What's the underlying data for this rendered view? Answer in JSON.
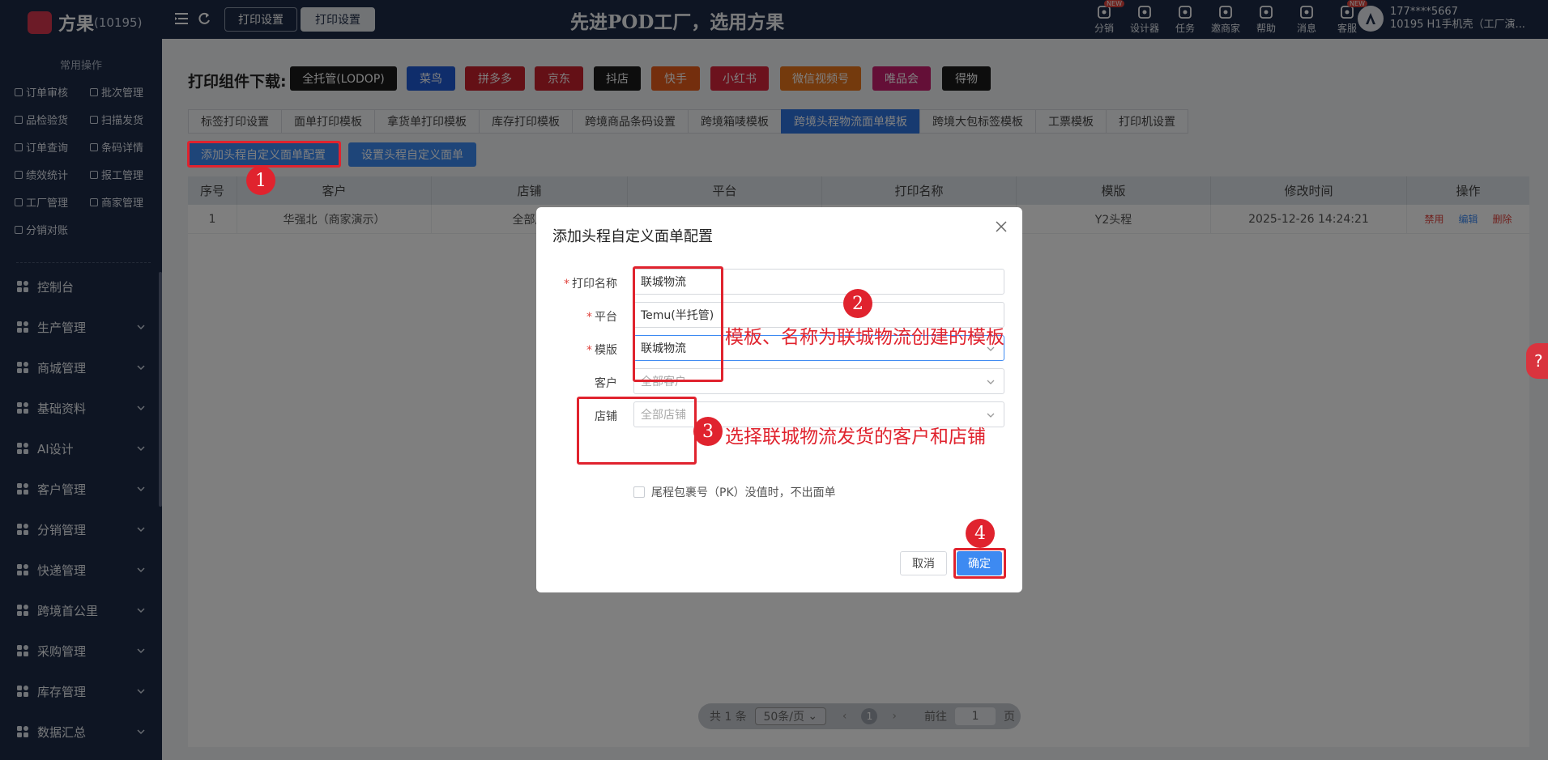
{
  "header": {
    "brand": "方果",
    "brand_code": "(10195)",
    "tabs": [
      "打印设置",
      "打印设置"
    ],
    "slogan": "先进POD工厂，选用方果",
    "icons": [
      {
        "label": "分销",
        "icon": "distribution-icon",
        "badge": "NEW"
      },
      {
        "label": "设计器",
        "icon": "image-icon",
        "badge": ""
      },
      {
        "label": "任务",
        "icon": "task-icon",
        "badge": ""
      },
      {
        "label": "邀商家",
        "icon": "invite-icon",
        "badge": ""
      },
      {
        "label": "帮助",
        "icon": "help-icon",
        "badge": ""
      },
      {
        "label": "消息",
        "icon": "message-icon",
        "badge": ""
      },
      {
        "label": "客服",
        "icon": "service-icon",
        "badge": "NEW"
      }
    ],
    "user_phone": "177****5667",
    "user_shop": "10195  H1手机壳（工厂演..."
  },
  "sidebar": {
    "quick_title": "常用操作",
    "quick_items": [
      "订单审核",
      "批次管理",
      "品检验货",
      "扫描发货",
      "订单查询",
      "条码详情",
      "绩效统计",
      "报工管理",
      "工厂管理",
      "商家管理",
      "分销对账"
    ],
    "menu": [
      {
        "label": "控制台",
        "icon": "dashboard-icon",
        "expandable": false
      },
      {
        "label": "生产管理",
        "icon": "production-icon",
        "expandable": true
      },
      {
        "label": "商城管理",
        "icon": "mall-icon",
        "expandable": true
      },
      {
        "label": "基础资料",
        "icon": "database-icon",
        "expandable": true
      },
      {
        "label": "AI设计",
        "icon": "ai-icon",
        "expandable": true
      },
      {
        "label": "客户管理",
        "icon": "customer-icon",
        "expandable": true
      },
      {
        "label": "分销管理",
        "icon": "distribution-icon",
        "expandable": true
      },
      {
        "label": "快递管理",
        "icon": "express-icon",
        "expandable": true
      },
      {
        "label": "跨境首公里",
        "icon": "globe-icon",
        "expandable": true
      },
      {
        "label": "采购管理",
        "icon": "purchase-icon",
        "expandable": true
      },
      {
        "label": "库存管理",
        "icon": "inventory-icon",
        "expandable": true
      },
      {
        "label": "数据汇总",
        "icon": "chart-icon",
        "expandable": true
      }
    ]
  },
  "downloads": {
    "label": "打印组件下载:",
    "buttons": [
      {
        "label": "全托管(LODOP)",
        "color": "#1a1a1a"
      },
      {
        "label": "菜鸟",
        "color": "#1e5bd6"
      },
      {
        "label": "拼多多",
        "color": "#c8202c"
      },
      {
        "label": "京东",
        "color": "#c8202c"
      },
      {
        "label": "抖店",
        "color": "#1a1a1a"
      },
      {
        "label": "快手",
        "color": "#e85c1a"
      },
      {
        "label": "小红书",
        "color": "#d8243a"
      },
      {
        "label": "微信视频号",
        "color": "#e8741a"
      },
      {
        "label": "唯品会",
        "color": "#c81e6e"
      },
      {
        "label": "得物",
        "color": "#1a1a1a"
      }
    ]
  },
  "tabs": [
    "标签打印设置",
    "面单打印模板",
    "拿货单打印模板",
    "库存打印模板",
    "跨境商品条码设置",
    "跨境箱唛模板",
    "跨境头程物流面单模板",
    "跨境大包标签模板",
    "工票模板",
    "打印机设置"
  ],
  "active_tab_index": 6,
  "actions": {
    "add": "添加头程自定义面单配置",
    "set": "设置头程自定义面单"
  },
  "table": {
    "columns": [
      "序号",
      "客户",
      "店铺",
      "平台",
      "打印名称",
      "模版",
      "修改时间",
      "操作"
    ],
    "rows": [
      {
        "index": "1",
        "customer": "华强北（商家演示）",
        "shop": "全部店",
        "platform": "",
        "print_name": "",
        "template": "Y2头程",
        "modified": "2025-12-26 14:24:21",
        "ops": [
          "禁用",
          "编辑",
          "删除"
        ]
      }
    ]
  },
  "pagination": {
    "total": "共 1 条",
    "page_size": "50条/页",
    "current": "1",
    "goto_label": "前往",
    "goto_value": "1",
    "page_unit": "页"
  },
  "dialog": {
    "title": "添加头程自定义面单配置",
    "fields": [
      {
        "label": "打印名称",
        "required": true,
        "value": "联城物流",
        "placeholder": ""
      },
      {
        "label": "平台",
        "required": true,
        "value": "Temu(半托管)",
        "placeholder": ""
      },
      {
        "label": "模版",
        "required": true,
        "value": "联城物流",
        "placeholder": ""
      },
      {
        "label": "客户",
        "required": false,
        "value": "",
        "placeholder": "全部客户"
      },
      {
        "label": "店铺",
        "required": false,
        "value": "",
        "placeholder": "全部店铺"
      }
    ],
    "checkbox": "尾程包裹号（PK）没值时，不出面单",
    "cancel": "取消",
    "ok": "确定"
  },
  "annotations": {
    "steps": [
      "1",
      "2",
      "3",
      "4"
    ],
    "note2": "模板、名称为联城物流创建的模板",
    "note3": "选择联城物流发货的客户和店铺",
    "color": "#e0232e"
  }
}
